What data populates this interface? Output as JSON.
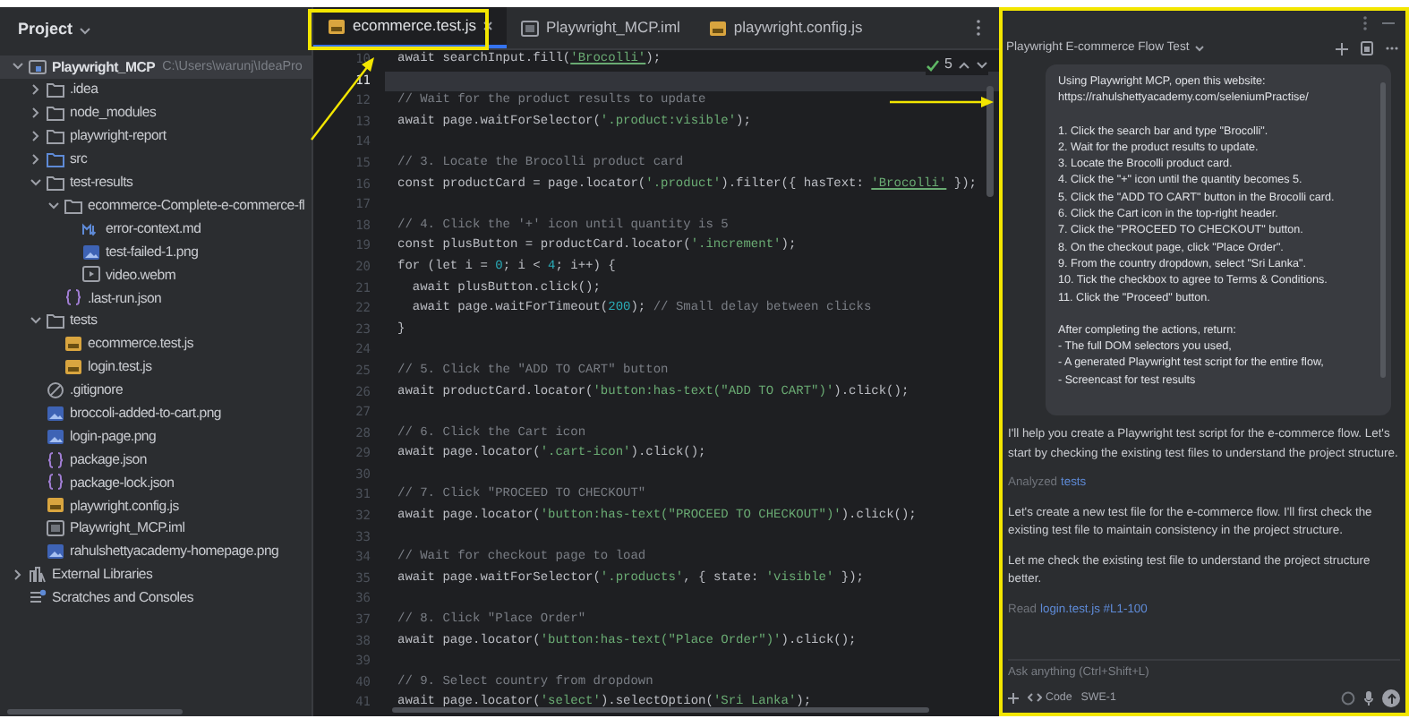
{
  "project_panel": {
    "title": "Project",
    "tree": [
      {
        "label": "Playwright_MCP",
        "path": "C:\\Users\\warunj\\IdeaPro",
        "kind": "project",
        "expanded": true,
        "selected": true,
        "children": [
          {
            "label": ".idea",
            "kind": "folder",
            "expanded": false,
            "selected": false
          },
          {
            "label": "node_modules",
            "kind": "folder",
            "expanded": false,
            "selected": false
          },
          {
            "label": "playwright-report",
            "kind": "folder",
            "expanded": false,
            "selected": false
          },
          {
            "label": "src",
            "kind": "source-folder",
            "expanded": false,
            "selected": false
          },
          {
            "label": "test-results",
            "kind": "folder",
            "expanded": true,
            "selected": false,
            "children": [
              {
                "label": "ecommerce-Complete-e-commerce-fl",
                "kind": "folder",
                "expanded": true,
                "selected": false,
                "children": [
                  {
                    "label": "error-context.md",
                    "kind": "markdown",
                    "selected": false
                  },
                  {
                    "label": "test-failed-1.png",
                    "kind": "image",
                    "selected": false
                  },
                  {
                    "label": "video.webm",
                    "kind": "video",
                    "selected": false
                  }
                ]
              },
              {
                "label": ".last-run.json",
                "kind": "json",
                "selected": false
              }
            ]
          },
          {
            "label": "tests",
            "kind": "folder",
            "expanded": true,
            "selected": false,
            "children": [
              {
                "label": "ecommerce.test.js",
                "kind": "js",
                "selected": false
              },
              {
                "label": "login.test.js",
                "kind": "js",
                "selected": false
              }
            ]
          },
          {
            "label": ".gitignore",
            "kind": "ignore",
            "selected": false
          },
          {
            "label": "broccoli-added-to-cart.png",
            "kind": "image",
            "selected": false
          },
          {
            "label": "login-page.png",
            "kind": "image",
            "selected": false
          },
          {
            "label": "package.json",
            "kind": "json",
            "selected": false
          },
          {
            "label": "package-lock.json",
            "kind": "json",
            "selected": false
          },
          {
            "label": "playwright.config.js",
            "kind": "js",
            "selected": false
          },
          {
            "label": "Playwright_MCP.iml",
            "kind": "module",
            "selected": false
          },
          {
            "label": "rahulshettyacademy-homepage.png",
            "kind": "image",
            "selected": false
          }
        ]
      },
      {
        "label": "External Libraries",
        "kind": "library",
        "expanded": false,
        "selected": false
      },
      {
        "label": "Scratches and Consoles",
        "kind": "scratches",
        "selected": false
      }
    ]
  },
  "editor": {
    "tabs": [
      {
        "label": "ecommerce.test.js",
        "kind": "js",
        "selected": true
      },
      {
        "label": "Playwright_MCP.iml",
        "kind": "module",
        "selected": false
      },
      {
        "label": "playwright.config.js",
        "kind": "js",
        "selected": false
      }
    ],
    "inspections": "5",
    "lines": [
      {
        "number": "10",
        "current": false,
        "segments": [
          {
            "kind": "code",
            "text": "await searchInput.fill("
          },
          {
            "kind": "flagged",
            "text": "'Brocolli'"
          },
          {
            "kind": "code",
            "text": ");"
          }
        ]
      },
      {
        "number": "11",
        "current": true
      },
      {
        "number": "12",
        "current": false,
        "segments": [
          {
            "kind": "comment",
            "text": "// Wait for the product results to update"
          }
        ]
      },
      {
        "number": "13",
        "current": false,
        "segments": [
          {
            "kind": "code",
            "text": "await page.waitForSelector("
          },
          {
            "kind": "string",
            "text": "'.product:visible'"
          },
          {
            "kind": "code",
            "text": ");"
          }
        ]
      },
      {
        "number": "14",
        "current": false
      },
      {
        "number": "15",
        "current": false,
        "segments": [
          {
            "kind": "comment",
            "text": "// 3. Locate the Brocolli product card"
          }
        ]
      },
      {
        "number": "16",
        "current": false,
        "segments": [
          {
            "kind": "code",
            "text": "const productCard = page.locator("
          },
          {
            "kind": "string",
            "text": "'.product'"
          },
          {
            "kind": "code",
            "text": ").filter({ hasText: "
          },
          {
            "kind": "flagged",
            "text": "'Brocolli'"
          },
          {
            "kind": "code",
            "text": " });"
          }
        ]
      },
      {
        "number": "17",
        "current": false
      },
      {
        "number": "18",
        "current": false,
        "segments": [
          {
            "kind": "comment",
            "text": "// 4. Click the '+' icon until quantity is 5"
          }
        ]
      },
      {
        "number": "19",
        "current": false,
        "segments": [
          {
            "kind": "code",
            "text": "const plusButton = productCard.locator("
          },
          {
            "kind": "string",
            "text": "'.increment'"
          },
          {
            "kind": "code",
            "text": ");"
          }
        ]
      },
      {
        "number": "20",
        "current": false,
        "segments": [
          {
            "kind": "code",
            "text": "for (let i = "
          },
          {
            "kind": "number",
            "text": "0"
          },
          {
            "kind": "code",
            "text": "; i < "
          },
          {
            "kind": "number",
            "text": "4"
          },
          {
            "kind": "code",
            "text": "; i++) {"
          }
        ]
      },
      {
        "number": "21",
        "current": false,
        "segments": [
          {
            "kind": "code",
            "text": "  await plusButton.click();"
          }
        ]
      },
      {
        "number": "22",
        "current": false,
        "segments": [
          {
            "kind": "code",
            "text": "  await page.waitForTimeout("
          },
          {
            "kind": "number",
            "text": "200"
          },
          {
            "kind": "code",
            "text": "); "
          },
          {
            "kind": "comment",
            "text": "// Small delay between clicks"
          }
        ]
      },
      {
        "number": "23",
        "current": false,
        "segments": [
          {
            "kind": "code",
            "text": "}"
          }
        ]
      },
      {
        "number": "24",
        "current": false
      },
      {
        "number": "25",
        "current": false,
        "segments": [
          {
            "kind": "comment",
            "text": "// 5. Click the \"ADD TO CART\" button"
          }
        ]
      },
      {
        "number": "26",
        "current": false,
        "segments": [
          {
            "kind": "code",
            "text": "await productCard.locator("
          },
          {
            "kind": "string",
            "text": "'button:has-text(\"ADD TO CART\")'"
          },
          {
            "kind": "code",
            "text": ").click();"
          }
        ]
      },
      {
        "number": "27",
        "current": false
      },
      {
        "number": "28",
        "current": false,
        "segments": [
          {
            "kind": "comment",
            "text": "// 6. Click the Cart icon"
          }
        ]
      },
      {
        "number": "29",
        "current": false,
        "segments": [
          {
            "kind": "code",
            "text": "await page.locator("
          },
          {
            "kind": "string",
            "text": "'.cart-icon'"
          },
          {
            "kind": "code",
            "text": ").click();"
          }
        ]
      },
      {
        "number": "30",
        "current": false
      },
      {
        "number": "31",
        "current": false,
        "segments": [
          {
            "kind": "comment",
            "text": "// 7. Click \"PROCEED TO CHECKOUT\""
          }
        ]
      },
      {
        "number": "32",
        "current": false,
        "segments": [
          {
            "kind": "code",
            "text": "await page.locator("
          },
          {
            "kind": "string",
            "text": "'button:has-text(\"PROCEED TO CHECKOUT\")'"
          },
          {
            "kind": "code",
            "text": ").click();"
          }
        ]
      },
      {
        "number": "33",
        "current": false
      },
      {
        "number": "34",
        "current": false,
        "segments": [
          {
            "kind": "comment",
            "text": "// Wait for checkout page to load"
          }
        ]
      },
      {
        "number": "35",
        "current": false,
        "segments": [
          {
            "kind": "code",
            "text": "await page.waitForSelector("
          },
          {
            "kind": "string",
            "text": "'.products'"
          },
          {
            "kind": "code",
            "text": ", { state: "
          },
          {
            "kind": "string",
            "text": "'visible'"
          },
          {
            "kind": "code",
            "text": " });"
          }
        ]
      },
      {
        "number": "36",
        "current": false
      },
      {
        "number": "37",
        "current": false,
        "segments": [
          {
            "kind": "comment",
            "text": "// 8. Click \"Place Order\""
          }
        ]
      },
      {
        "number": "38",
        "current": false,
        "segments": [
          {
            "kind": "code",
            "text": "await page.locator("
          },
          {
            "kind": "string",
            "text": "'button:has-text(\"Place Order\")'"
          },
          {
            "kind": "code",
            "text": ").click();"
          }
        ]
      },
      {
        "number": "39",
        "current": false
      },
      {
        "number": "40",
        "current": false,
        "segments": [
          {
            "kind": "comment",
            "text": "// 9. Select country from dropdown"
          }
        ]
      },
      {
        "number": "41",
        "current": false,
        "segments": [
          {
            "kind": "code",
            "text": "await page.locator("
          },
          {
            "kind": "string",
            "text": "'select'"
          },
          {
            "kind": "code",
            "text": ").selectOption("
          },
          {
            "kind": "string",
            "text": "'Sri Lanka'"
          },
          {
            "kind": "code",
            "text": ");"
          }
        ]
      }
    ]
  },
  "chat": {
    "title": "Playwright E-commerce Flow Test",
    "prompt": [
      [
        "Using Playwright MCP, open this website:",
        "https://rahulshettyacademy.com/seleniumPractise/"
      ],
      [
        "1. Click the search bar and type \"Brocolli\".",
        "2. Wait for the product results to update.",
        "3. Locate the Brocolli product card.",
        "4. Click the \"+\" icon until the quantity becomes 5.",
        "5. Click the \"ADD TO CART\" button in the Brocolli card.",
        "6. Click the Cart icon in the top-right header.",
        "7. Click the \"PROCEED TO CHECKOUT\" button.",
        "8. On the checkout page, click \"Place Order\".",
        "9. From the country dropdown, select \"Sri Lanka\".",
        "10. Tick the checkbox to agree to Terms & Conditions.",
        "11. Click the \"Proceed\" button."
      ],
      [
        "After completing the actions, return:",
        "- The full DOM selectors you used,",
        "- A generated Playwright test script for the entire flow,",
        "- Screencast for test results"
      ]
    ],
    "messages": [
      {
        "kind": "text",
        "text": "I'll help you create a Playwright test script for the e-commerce flow. Let's start by checking the existing test files to understand the project structure."
      },
      {
        "kind": "action",
        "verb": "Analyzed",
        "target": "tests"
      },
      {
        "kind": "text",
        "text": "Let's create a new test file for the e-commerce flow. I'll first check the existing test file to maintain consistency in the project structure."
      },
      {
        "kind": "text",
        "text": "Let me check the existing test file to understand the project structure better."
      },
      {
        "kind": "action",
        "verb": "Read",
        "target": "login.test.js #L1-100"
      }
    ],
    "input": {
      "placeholder": "Ask anything (Ctrl+Shift+L)"
    },
    "mode": "Code",
    "model": "SWE-1"
  }
}
